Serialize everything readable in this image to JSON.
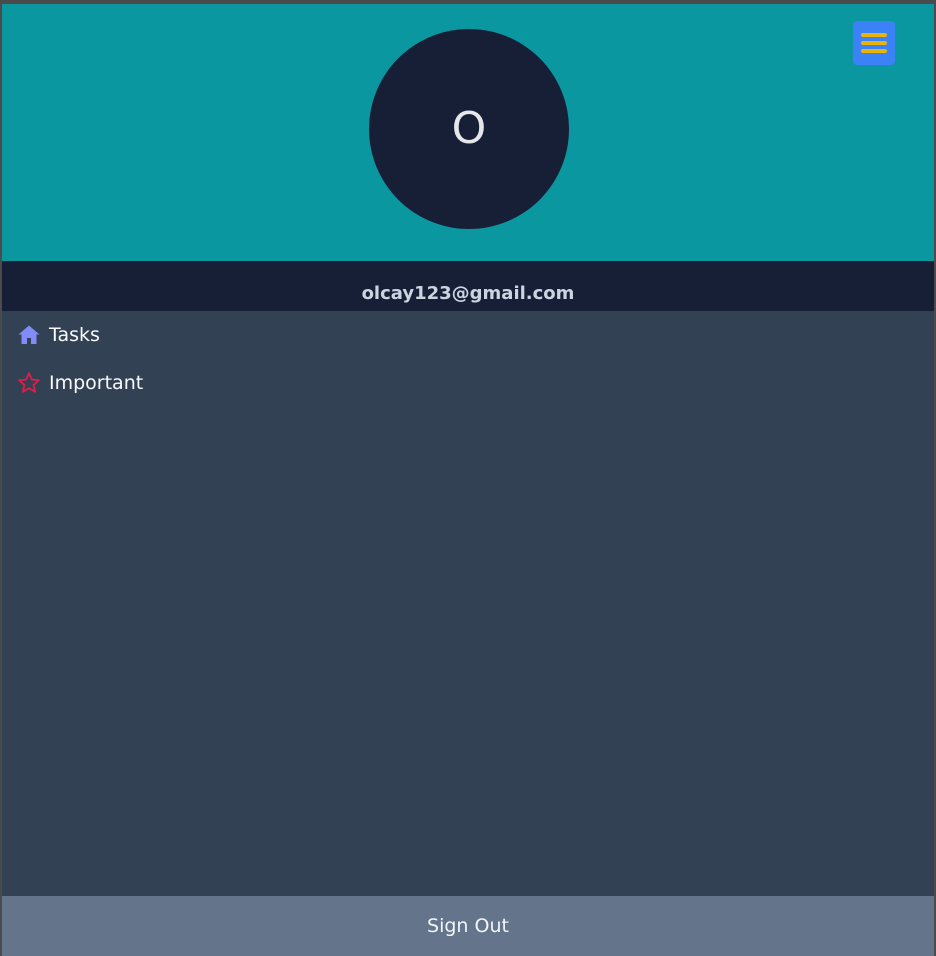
{
  "profile": {
    "avatar_initial": "O",
    "email": "olcay123@gmail.com"
  },
  "header": {
    "menu_icon": "hamburger-icon"
  },
  "nav": {
    "items": [
      {
        "label": "Tasks",
        "icon": "home-icon",
        "icon_color": "#818cf8"
      },
      {
        "label": "Important",
        "icon": "star-icon",
        "icon_color": "#e11d48"
      }
    ]
  },
  "footer": {
    "signout_label": "Sign Out"
  },
  "colors": {
    "hero_bg": "#0a97a0",
    "avatar_bg": "#171f36",
    "email_bar_bg": "#171f36",
    "sidebar_bg": "#334155",
    "signout_bg": "#64748b",
    "menu_button_bg": "#3b82f6",
    "menu_bars": "#eab308"
  }
}
